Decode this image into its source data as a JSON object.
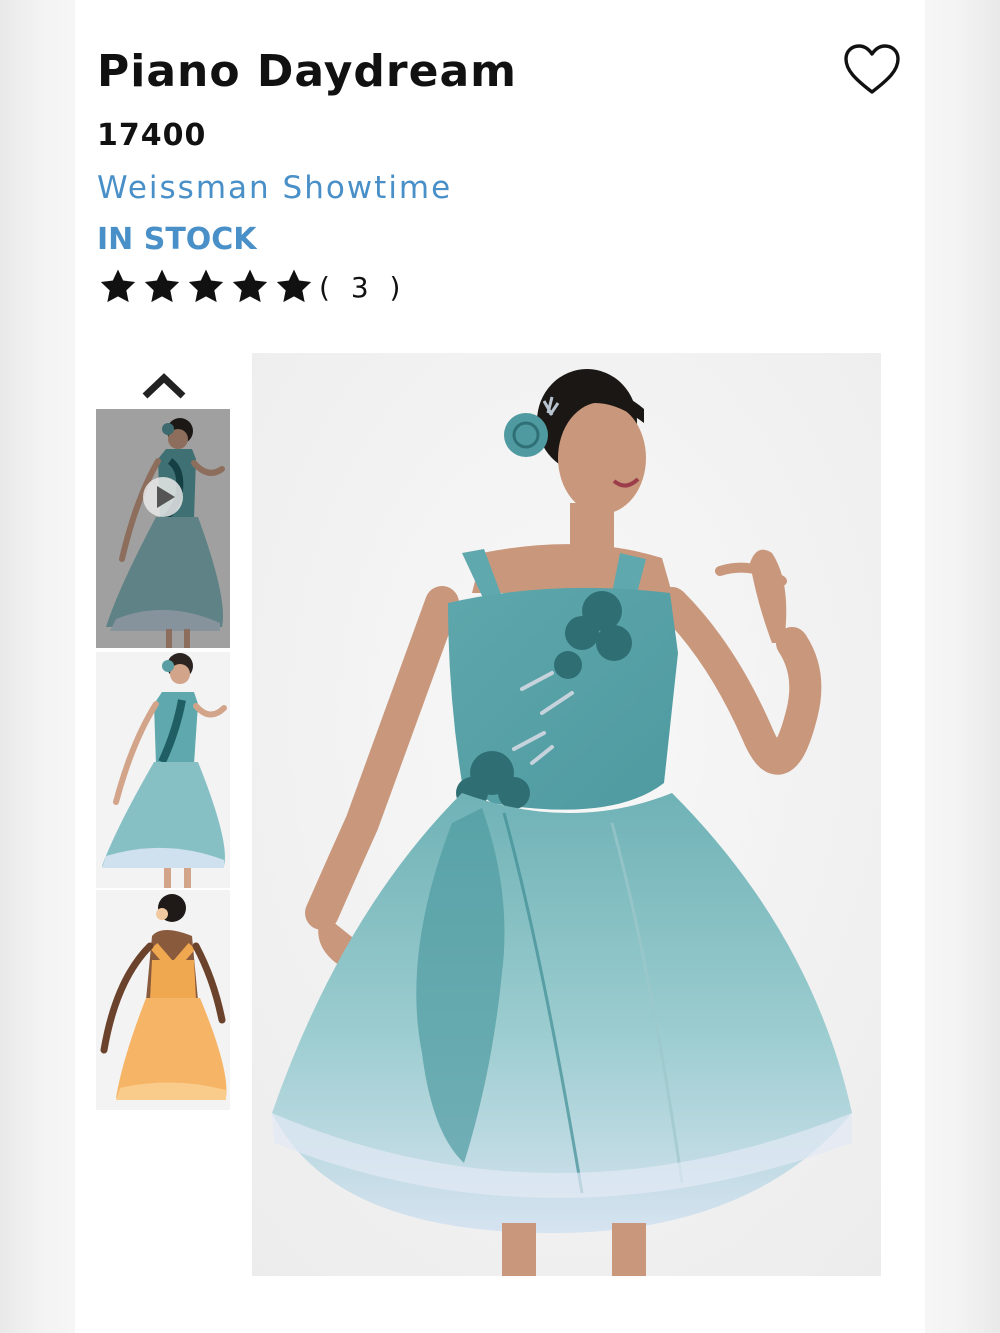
{
  "product": {
    "title": "Piano Daydream",
    "sku": "17400",
    "brand": "Weissman Showtime",
    "stock_status": "IN STOCK",
    "rating": 5,
    "rating_max": 5,
    "review_count": "( 3 )"
  },
  "gallery": {
    "thumbnails": [
      {
        "icon": "play-icon",
        "color": "teal"
      },
      {
        "color": "teal"
      },
      {
        "color": "orange"
      }
    ],
    "scroll_up_icon": "chevron-up-icon"
  },
  "icons": {
    "favorite": "heart-icon",
    "rating": "star-icon"
  },
  "colors": {
    "brand": "#4a90c8",
    "text": "#111111",
    "dress_teal": "#5fa8ad",
    "dress_orange": "#f2b060"
  }
}
